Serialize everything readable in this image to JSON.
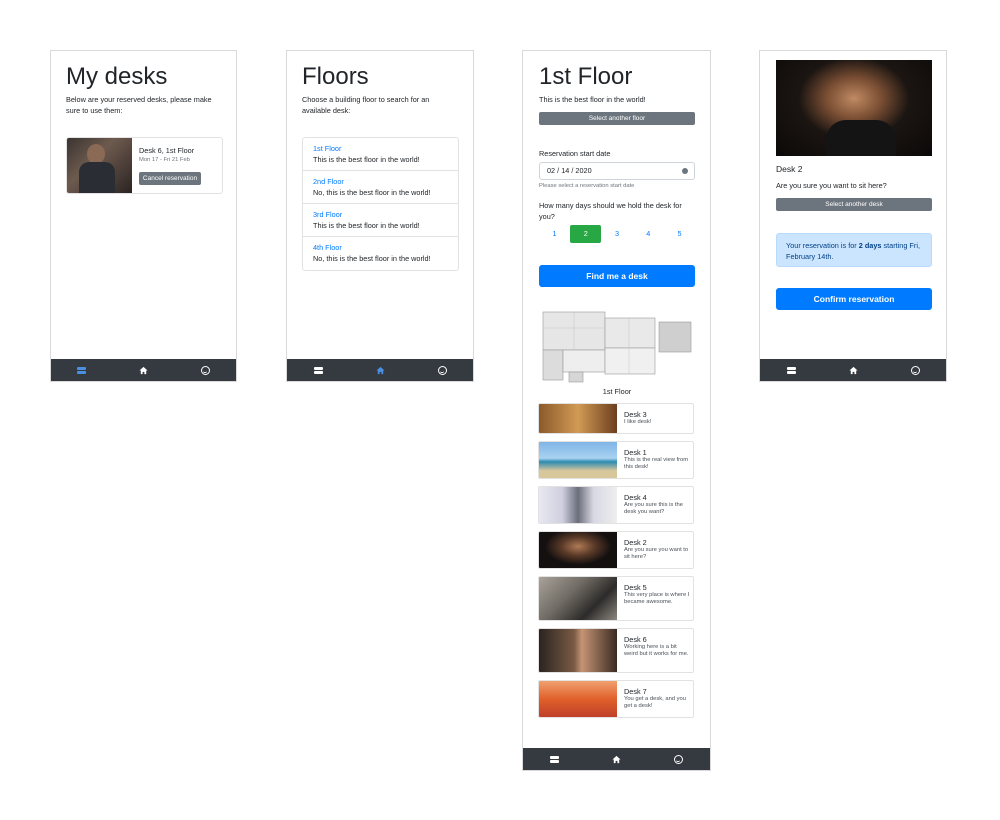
{
  "screen1": {
    "title": "My desks",
    "description": "Below are your reserved desks, please make sure to use them:",
    "reservation": {
      "name": "Desk 6, 1st Floor",
      "dates": "Mon 17 - Fri 21 Feb",
      "cancel_label": "Cancel reservation"
    }
  },
  "screen2": {
    "title": "Floors",
    "description": "Choose a building floor to search for an available desk:",
    "floors": [
      {
        "name": "1st Floor",
        "desc": "This is the best floor in the world!"
      },
      {
        "name": "2nd Floor",
        "desc": "No, this is the best floor in the world!"
      },
      {
        "name": "3rd Floor",
        "desc": "This is the best floor in the world!"
      },
      {
        "name": "4th Floor",
        "desc": "No, this is the best floor in the world!"
      }
    ]
  },
  "screen3": {
    "title": "1st Floor",
    "subtitle": "This is the best floor in the world!",
    "select_floor_label": "Select another floor",
    "date_label": "Reservation start date",
    "date_value": "02 / 14 / 2020",
    "date_help": "Please select a reservation start date",
    "days_question": "How many days should we hold the desk for you?",
    "days": [
      "1",
      "2",
      "3",
      "4",
      "5"
    ],
    "selected_days": "2",
    "find_label": "Find me a desk",
    "map_caption": "1st Floor",
    "desks": [
      {
        "name": "Desk 3",
        "desc": "I like desk!"
      },
      {
        "name": "Desk 1",
        "desc": "This is the real view from this desk!"
      },
      {
        "name": "Desk 4",
        "desc": "Are you sure this is the desk you want?"
      },
      {
        "name": "Desk 2",
        "desc": "Are you sure you want to sit here?"
      },
      {
        "name": "Desk 5",
        "desc": "This very place is where I became awesome."
      },
      {
        "name": "Desk 6",
        "desc": "Working here is a bit weird but it works for me."
      },
      {
        "name": "Desk 7",
        "desc": "You get a desk, and you get a desk!"
      }
    ]
  },
  "screen4": {
    "desk_name": "Desk 2",
    "question": "Are you sure you want to sit here?",
    "select_desk_label": "Select another desk",
    "alert_prefix": "Your reservation is for ",
    "alert_days": "2 days",
    "alert_suffix": " starting Fri, February 14th.",
    "confirm_label": "Confirm reservation"
  },
  "colors": {
    "primary": "#007bff",
    "secondary": "#6c757d",
    "success": "#28a745",
    "tabbar": "#343a40",
    "active_tab": "#4a90e2",
    "alert_bg": "#cce5ff"
  },
  "tabs": [
    "list-icon",
    "home-icon",
    "smiley-icon"
  ]
}
